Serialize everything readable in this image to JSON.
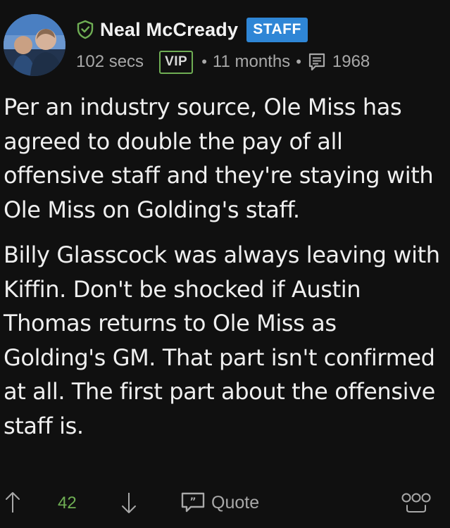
{
  "author": {
    "name": "Neal McCready",
    "role_badge": "STAFF"
  },
  "meta": {
    "reading_time": "102 secs",
    "membership_badge": "VIP",
    "separator": "•",
    "posted_ago": "11 months",
    "post_count": "1968"
  },
  "body": {
    "paragraphs": [
      "Per an industry source, Ole Miss has agreed to double the pay of all offensive staff and they're staying with Ole Miss on Golding's staff.",
      "Billy Glasscock was always leaving with Kiffin. Don't be shocked if Austin Thomas returns to Ole Miss as Golding's GM. That part isn't confirmed at all. The first part about the offensive staff is."
    ]
  },
  "footer": {
    "vote_count": "42",
    "quote_label": "Quote"
  },
  "icons": {
    "verified": "shield-check-icon",
    "posts": "message-list-icon",
    "upvote": "arrow-up-icon",
    "downvote": "arrow-down-icon",
    "quote": "quote-bubble-icon",
    "reaction": "reaction-icon"
  },
  "colors": {
    "background": "#101010",
    "staff_badge": "#2f86d6",
    "vip_border": "#6fae54",
    "vote_count": "#6fae54",
    "muted_text": "#a8a8a8"
  }
}
